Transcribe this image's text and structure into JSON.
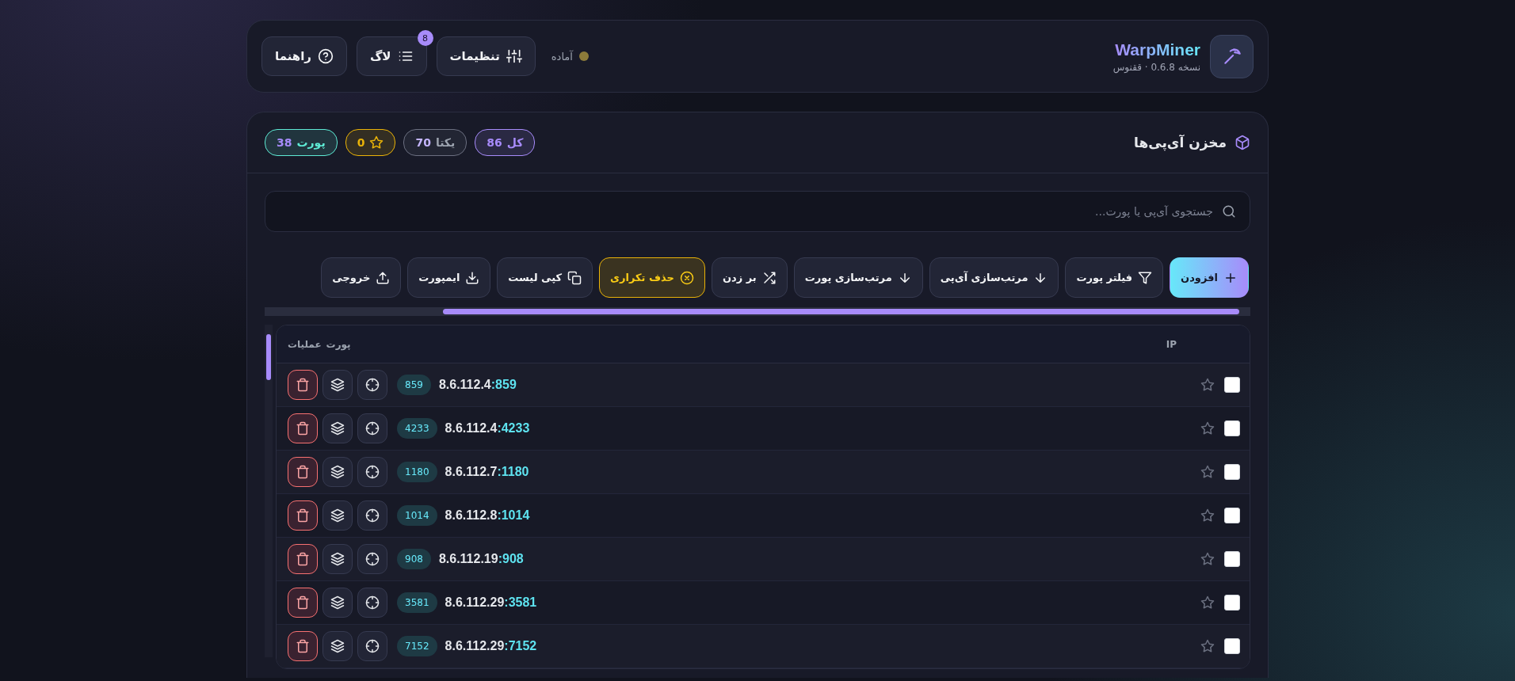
{
  "header": {
    "app_name": "WarpMiner",
    "version": "نسخه 0.6.8 · ققنوس",
    "status": {
      "label": "آماده",
      "color": "#8c7b3a"
    },
    "buttons": [
      {
        "kind": "settings",
        "label": "تنظیمات"
      },
      {
        "kind": "log",
        "label": "لاگ",
        "badge": "8"
      },
      {
        "kind": "help",
        "label": "راهنما"
      }
    ]
  },
  "panel": {
    "title": "مخزن آی‌پی‌ها",
    "stats": [
      {
        "kind": "count",
        "label": "کل",
        "value": "86",
        "color": "#a78bfa"
      },
      {
        "kind": "count",
        "label": "یکتا",
        "value": "70",
        "color": "#6b6f80"
      },
      {
        "kind": "starred",
        "value": "0",
        "color": "#eab308"
      },
      {
        "kind": "count",
        "label": "پورت",
        "value": "38",
        "color": "#5eead4"
      }
    ],
    "search": {
      "placeholder": "جستجوی آی‌پی یا پورت..."
    },
    "toolbar": [
      {
        "kind": "add",
        "label": "افزودن"
      },
      {
        "kind": "filter",
        "label": "فیلتر پورت"
      },
      {
        "kind": "sort",
        "label": "مرتب‌سازی آی‌پی"
      },
      {
        "kind": "sort",
        "label": "مرتب‌سازی پورت"
      },
      {
        "kind": "shuffle",
        "label": "بر زدن"
      },
      {
        "kind": "dedupe",
        "label": "حذف تکراری"
      },
      {
        "kind": "copy",
        "label": "کپی لیست"
      },
      {
        "kind": "import",
        "label": "ایمپورت"
      },
      {
        "kind": "export",
        "label": "خروجی"
      }
    ],
    "table": {
      "columns": [
        "IP",
        "پورت",
        "عملیات"
      ],
      "rows": [
        {
          "checked": false,
          "starred": false,
          "address": "8.6.112.4**:859**",
          "port": "859"
        },
        {
          "checked": false,
          "starred": false,
          "address": "8.6.112.4**:4233**",
          "port": "4233"
        },
        {
          "checked": false,
          "starred": false,
          "address": "8.6.112.7**:1180**",
          "port": "1180"
        },
        {
          "checked": false,
          "starred": false,
          "address": "8.6.112.8**:1014**",
          "port": "1014"
        },
        {
          "checked": false,
          "starred": false,
          "address": "8.6.112.19**:908**",
          "port": "908"
        },
        {
          "checked": false,
          "starred": false,
          "address": "8.6.112.29**:3581**",
          "port": "3581"
        },
        {
          "checked": false,
          "starred": false,
          "address": "8.6.112.29**:7152**",
          "port": "7152"
        }
      ]
    }
  }
}
